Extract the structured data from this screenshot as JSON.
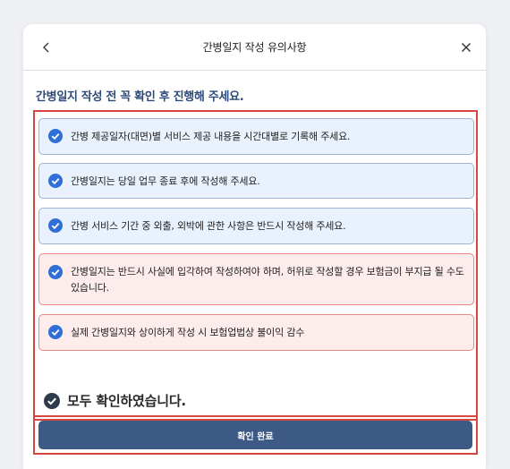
{
  "header": {
    "title": "간병일지 작성 유의사항"
  },
  "intro": "간병일지 작성 전 꼭 확인 후 진행해 주세요.",
  "notices": [
    {
      "text": "간병 제공일자(대면)별 서비스 제공 내용을 시간대별로 기록해 주세요.",
      "style": "blue"
    },
    {
      "text": "간병일지는 당일 업무 종료 후에 작성해 주세요.",
      "style": "blue"
    },
    {
      "text": "간병 서비스 기간 중 외출, 외박에 관한 사항은 반드시 작성해 주세요.",
      "style": "blue"
    },
    {
      "text": "간병일지는 반드시 사실에 입각하여 작성하여야 하며, 허위로 작성할 경우 보험금이 부지급 될 수도 있습니다.",
      "style": "red"
    },
    {
      "text": "실제 간병일지와 상이하게 작성 시 보험업법상 불이익 감수",
      "style": "red"
    }
  ],
  "confirm_all": "모두 확인하였습니다.",
  "complete_button": "확인 완료",
  "colors": {
    "check_blue": "#2f6fd6",
    "check_dark": "#2f3a4c",
    "highlight_red": "#d6483f",
    "button_bg": "#3d5a86"
  },
  "icons": {
    "back": "chevron-left-icon",
    "close": "close-icon",
    "check": "check-circle-icon"
  }
}
